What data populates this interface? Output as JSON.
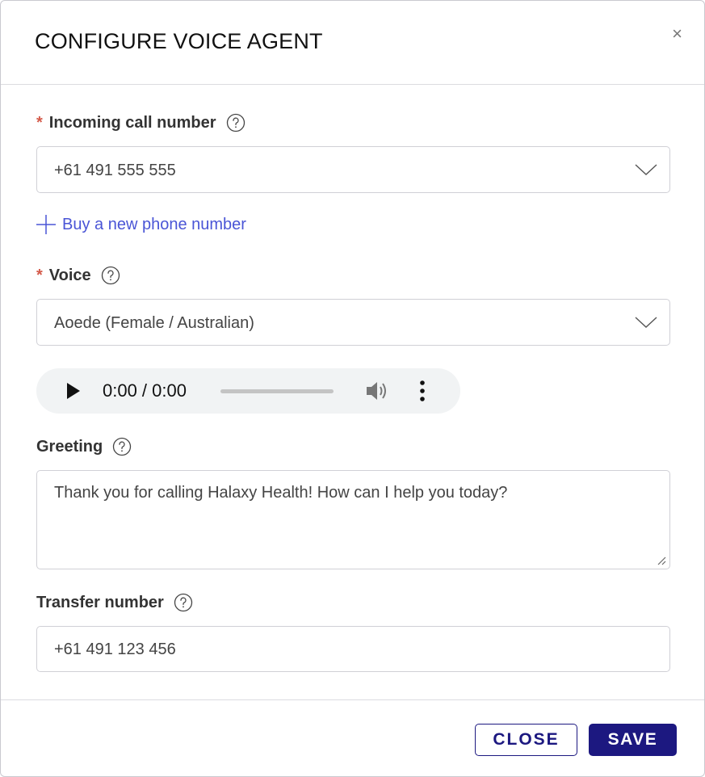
{
  "dialog": {
    "title": "CONFIGURE VOICE AGENT",
    "close_glyph": "×"
  },
  "incoming_number": {
    "required_mark": "*",
    "label": "Incoming call number",
    "value": "+61 491 555 555"
  },
  "buy_link": {
    "label": "Buy a new phone number"
  },
  "voice": {
    "required_mark": "*",
    "label": "Voice",
    "value": "Aoede (Female / Australian)"
  },
  "audio_player": {
    "time": "0:00 / 0:00",
    "progress": 0
  },
  "greeting": {
    "label": "Greeting",
    "value": "Thank you for calling Halaxy Health! How can I help you today?"
  },
  "transfer_number": {
    "label": "Transfer number",
    "value": "+61 491 123 456"
  },
  "footer": {
    "close_label": "CLOSE",
    "save_label": "SAVE"
  },
  "colors": {
    "primary": "#1c1880",
    "link": "#4a55d6",
    "required": "#d45a4a"
  },
  "icons": [
    "close-icon",
    "help-icon",
    "chevron-down-icon",
    "plus-icon",
    "play-icon",
    "volume-icon",
    "more-vertical-icon",
    "resize-grip-icon"
  ]
}
